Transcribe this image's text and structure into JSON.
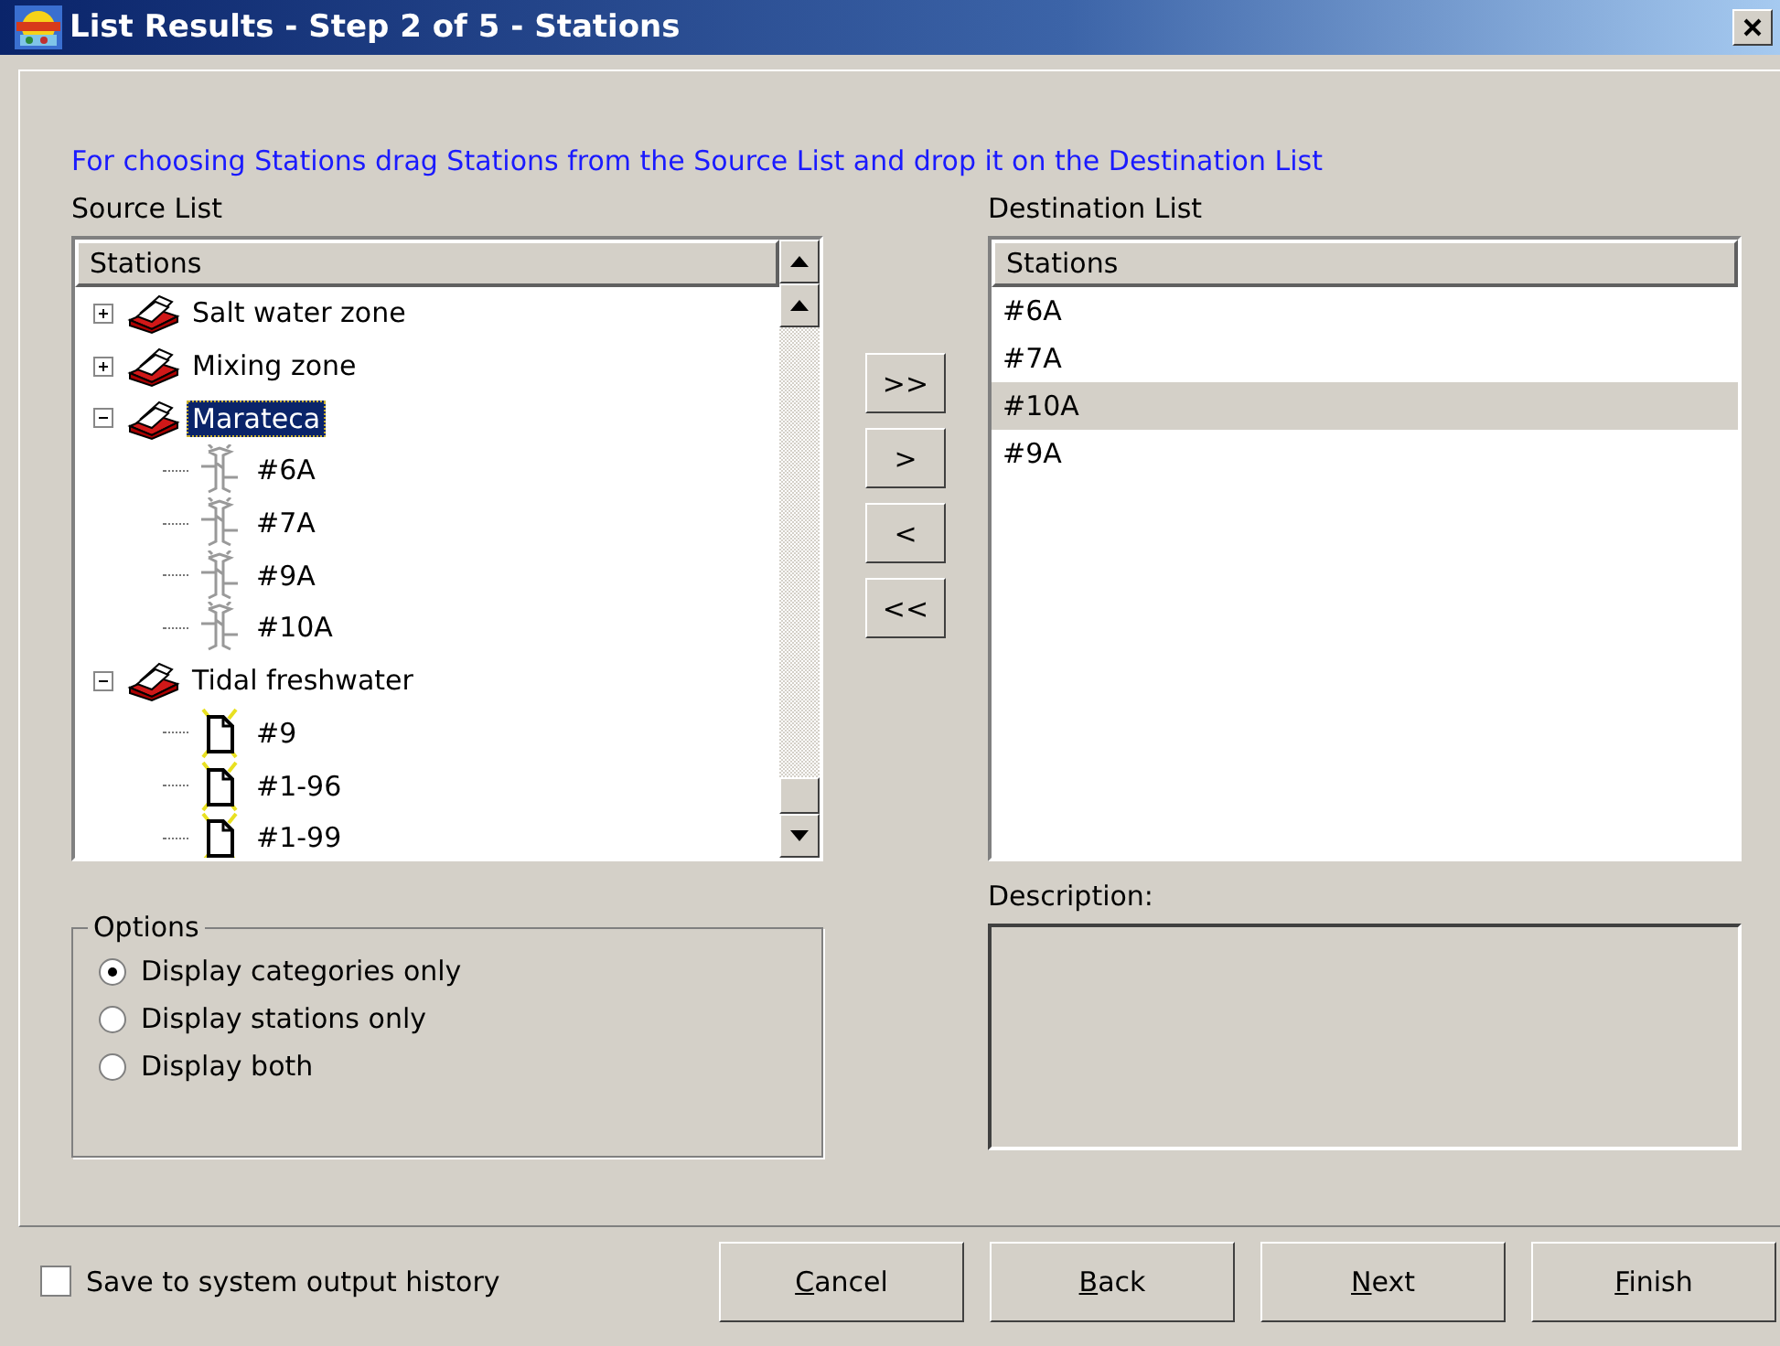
{
  "window": {
    "title": "List Results - Step 2 of 5 - Stations"
  },
  "instruction": "For choosing Stations drag Stations from the Source List and drop it on the Destination List",
  "source_list": {
    "label": "Source List",
    "column": "Stations",
    "tree": [
      {
        "label": "Salt water zone",
        "kind": "category",
        "expanded": false,
        "selected": false
      },
      {
        "label": "Mixing zone",
        "kind": "category",
        "expanded": false,
        "selected": false
      },
      {
        "label": "Marateca",
        "kind": "category",
        "expanded": true,
        "selected": true,
        "children": [
          {
            "label": "#6A",
            "kind": "station",
            "selected": false
          },
          {
            "label": "#7A",
            "kind": "station",
            "selected": false
          },
          {
            "label": "#9A",
            "kind": "station",
            "selected": false
          },
          {
            "label": "#10A",
            "kind": "station",
            "selected": false
          }
        ]
      },
      {
        "label": "Tidal freshwater",
        "kind": "category",
        "expanded": true,
        "selected": false,
        "children": [
          {
            "label": "#9",
            "kind": "document",
            "selected": false
          },
          {
            "label": "#1-96",
            "kind": "document",
            "selected": false
          },
          {
            "label": "#1-99",
            "kind": "document",
            "selected": false
          }
        ]
      }
    ]
  },
  "move_buttons": [
    ">>",
    ">",
    "<",
    "<<"
  ],
  "destination_list": {
    "label": "Destination List",
    "column": "Stations",
    "items": [
      {
        "label": "#6A",
        "selected": false
      },
      {
        "label": "#7A",
        "selected": false
      },
      {
        "label": "#10A",
        "selected": true
      },
      {
        "label": "#9A",
        "selected": false
      }
    ]
  },
  "options": {
    "title": "Options",
    "choices": [
      {
        "label": "Display categories only",
        "selected": true
      },
      {
        "label": "Display stations only",
        "selected": false
      },
      {
        "label": "Display both",
        "selected": false
      }
    ]
  },
  "description": {
    "label": "Description:"
  },
  "save_history": {
    "label": "Save to system output history",
    "checked": false
  },
  "buttons": [
    "Cancel",
    "Back",
    "Next",
    "Finish"
  ]
}
